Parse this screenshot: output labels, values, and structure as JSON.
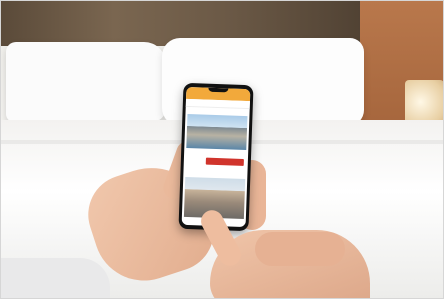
{
  "phone_app": {
    "header_title": "",
    "sub_left": "",
    "sub_right": "",
    "card_title": "",
    "card_text": "",
    "button_label": "",
    "second_caption": ""
  }
}
